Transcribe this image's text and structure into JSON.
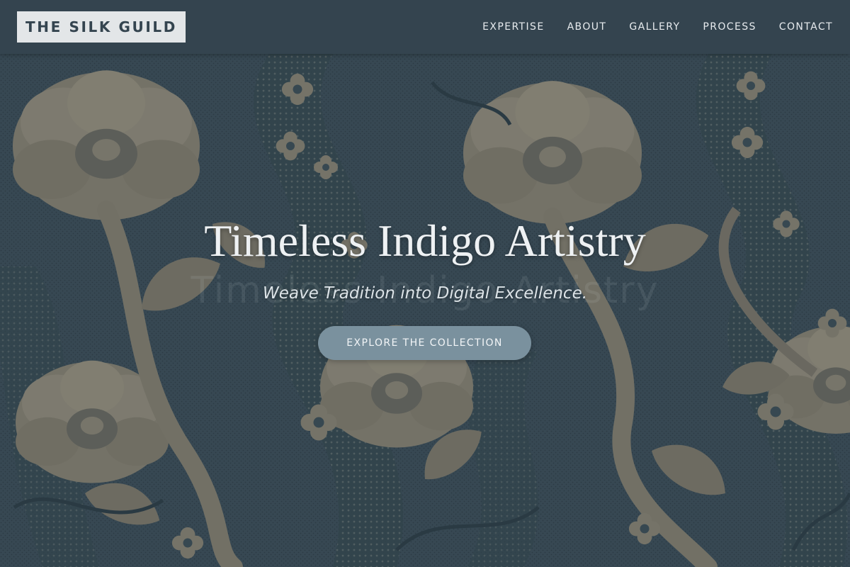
{
  "brand": {
    "name": "THE SILK GUILD"
  },
  "nav": {
    "items": [
      {
        "label": "EXPERTISE"
      },
      {
        "label": "ABOUT"
      },
      {
        "label": "GALLERY"
      },
      {
        "label": "PROCESS"
      },
      {
        "label": "CONTACT"
      }
    ]
  },
  "hero": {
    "title": "Timeless Indigo Artistry",
    "ghost_text": "Timeless Indigo Artistry",
    "subtitle": "Weave Tradition into Digital Excellence.",
    "cta_label": "EXPLORE THE COLLECTION",
    "background": "damask-fabric-pattern"
  },
  "colors": {
    "header_bg": "#34444f",
    "logo_bg": "#e3e6e8",
    "logo_text": "#34444f",
    "fabric_base": "#3a4d58",
    "fabric_motif": "#8c8676",
    "cta_bg": "#7a919e",
    "text_light": "#eef1f3"
  }
}
